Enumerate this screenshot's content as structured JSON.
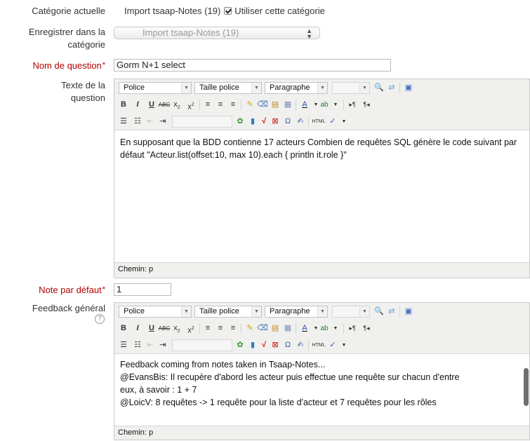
{
  "form": {
    "current_category": {
      "label": "Catégorie actuelle",
      "value": "Import tsaap-Notes (19)",
      "use_label": "Utiliser cette catégorie",
      "use_checked": true
    },
    "save_in_category": {
      "label_line1": "Enregistrer dans la",
      "label_line2": "catégorie",
      "selected": "Import tsaap-Notes (19)"
    },
    "question_name": {
      "label": "Nom de question",
      "required_marker": "*",
      "value": "Gorm N+1 select"
    },
    "question_text": {
      "label_line1": "Texte de la",
      "label_line2": "question",
      "content": "En supposant que la BDD contienne 17 acteurs Combien de requêtes SQL génère le code suivant par défaut \"Acteur.list(offset:10, max 10).each { println it.role }\"",
      "path": "Chemin: p"
    },
    "default_mark": {
      "label": "Note par défaut",
      "required_marker": "*",
      "value": "1"
    },
    "general_feedback": {
      "label": "Feedback général",
      "lines": [
        "Feedback coming from notes taken in Tsaap-Notes...",
        "@EvansBis: Il recupère d'abord les acteur puis effectue une requête sur chacun d'entre",
        "eux, à savoir : 1 + 7",
        "@LoicV: 8 requêtes -> 1 requête pour la liste d'acteur et 7 requêtes pour les rôles"
      ],
      "path": "Chemin: p"
    }
  },
  "toolbar": {
    "font_label": "Police",
    "size_label": "Taille police",
    "format_label": "Paragraphe"
  }
}
